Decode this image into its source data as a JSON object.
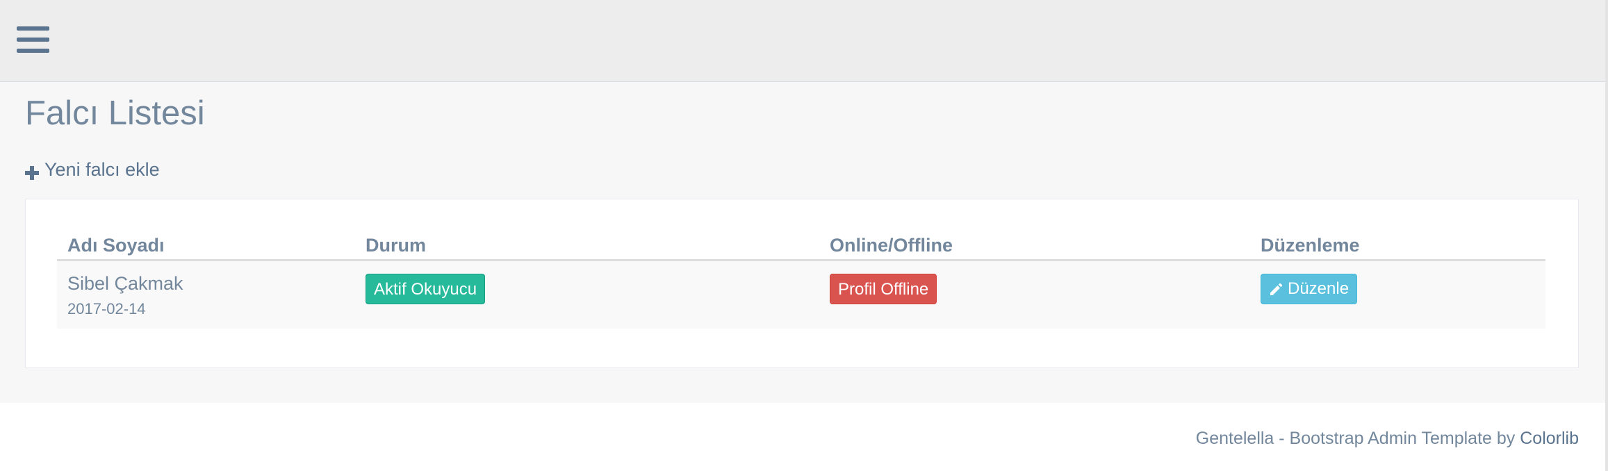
{
  "topbar": {
    "menu_icon": "menu-bars-icon"
  },
  "page": {
    "title": "Falcı Listesi",
    "add_link_icon": "plus-icon",
    "add_link_label": "Yeni falcı ekle"
  },
  "table": {
    "headers": [
      "Adı Soyadı",
      "Durum",
      "Online/Offline",
      "Düzenleme"
    ],
    "rows": [
      {
        "name": "Sibel Çakmak",
        "date": "2017-02-14",
        "status": "Aktif Okuyucu",
        "online": "Profil Offline",
        "edit_icon": "pencil-icon",
        "edit_label": "Düzenle"
      }
    ]
  },
  "footer": {
    "text": "Gentelella - Bootstrap Admin Template by ",
    "link": "Colorlib"
  },
  "colors": {
    "topbar_bg": "#EDEDED",
    "content_bg": "#F7F7F7",
    "text": "#73879C",
    "success": "#26B99A",
    "danger": "#D9534F",
    "info": "#5BC0DE"
  }
}
